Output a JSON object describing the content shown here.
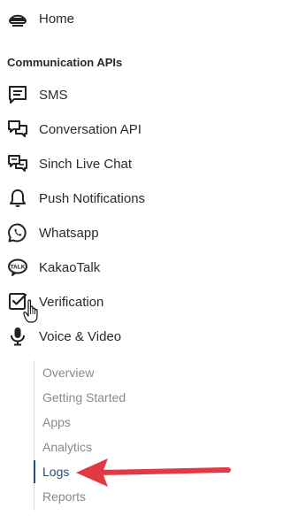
{
  "nav": {
    "home": {
      "label": "Home",
      "icon": "helmet-icon"
    },
    "section_heading": "Communication APIs",
    "items": [
      {
        "label": "SMS",
        "icon": "message-lines-icon"
      },
      {
        "label": "Conversation API",
        "icon": "conversation-bubbles-icon"
      },
      {
        "label": "Sinch Live Chat",
        "icon": "live-chat-icon"
      },
      {
        "label": "Push Notifications",
        "icon": "bell-icon"
      },
      {
        "label": "Whatsapp",
        "icon": "whatsapp-icon"
      },
      {
        "label": "KakaoTalk",
        "icon": "kakaotalk-icon"
      },
      {
        "label": "Verification",
        "icon": "checkbox-icon"
      },
      {
        "label": "Voice & Video",
        "icon": "microphone-icon"
      }
    ],
    "subitems": [
      {
        "label": "Overview"
      },
      {
        "label": "Getting Started"
      },
      {
        "label": "Apps"
      },
      {
        "label": "Analytics"
      },
      {
        "label": "Logs",
        "active": true
      },
      {
        "label": "Reports"
      }
    ],
    "kakao_badge_text": "TALK"
  },
  "colors": {
    "active_accent": "#1e4f87",
    "annotation_arrow": "#e03a44",
    "sub_text": "#8a8a8a"
  }
}
